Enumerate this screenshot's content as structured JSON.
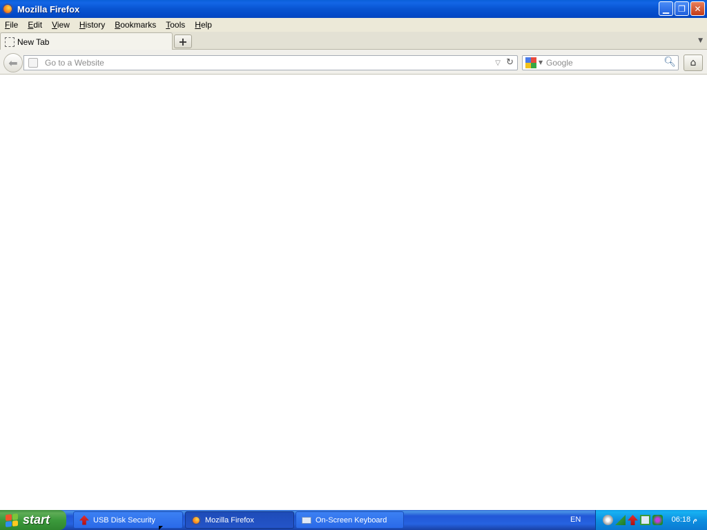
{
  "window": {
    "title": "Mozilla Firefox"
  },
  "menubar": {
    "items": [
      {
        "label": "File",
        "key": "F",
        "rest": "ile"
      },
      {
        "label": "Edit",
        "key": "E",
        "rest": "dit"
      },
      {
        "label": "View",
        "key": "V",
        "rest": "iew"
      },
      {
        "label": "History",
        "key": "H",
        "rest": "istory"
      },
      {
        "label": "Bookmarks",
        "key": "B",
        "rest": "ookmarks"
      },
      {
        "label": "Tools",
        "key": "T",
        "rest": "ools"
      },
      {
        "label": "Help",
        "key": "H",
        "rest": "elp"
      }
    ]
  },
  "tabs": [
    {
      "label": "New Tab",
      "active": true
    }
  ],
  "toolbar": {
    "address_placeholder": "Go to a Website",
    "address_value": "",
    "search_placeholder": "Google",
    "search_engine_icon": "google-icon"
  },
  "taskbar": {
    "start_label": "start",
    "buttons": [
      {
        "label": "USB Disk Security",
        "icon": "usb-disk-security-icon",
        "active": false
      },
      {
        "label": "Mozilla Firefox",
        "icon": "firefox-icon",
        "active": true
      },
      {
        "label": "On-Screen Keyboard",
        "icon": "keyboard-icon",
        "active": false
      }
    ],
    "language": "EN",
    "clock": "06:18 م",
    "tray_icons": [
      "messenger-icon",
      "network-icon",
      "usb-security-tray-icon",
      "display-icon",
      "security-shield-icon"
    ]
  },
  "colors": {
    "titlebar": "#0854d1",
    "taskbar": "#2157d7",
    "start": "#3c9a3c",
    "tray": "#0d8fe0"
  }
}
